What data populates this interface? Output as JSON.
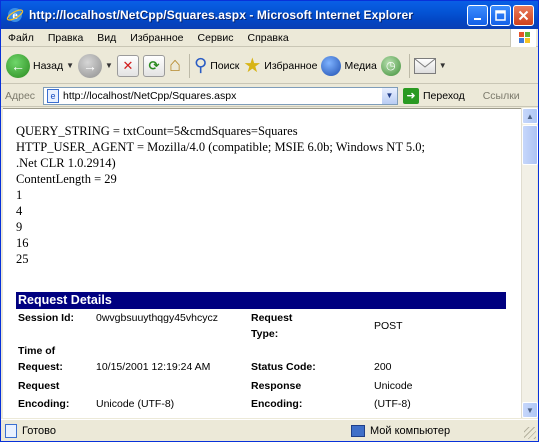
{
  "window": {
    "title": "http://localhost/NetCpp/Squares.aspx - Microsoft Internet Explorer"
  },
  "menu": [
    "Файл",
    "Правка",
    "Вид",
    "Избранное",
    "Сервис",
    "Справка"
  ],
  "toolbar": {
    "back_label": "Назад",
    "search_label": "Поиск",
    "favorites_label": "Избранное",
    "media_label": "Медиа"
  },
  "address": {
    "label": "Адрес",
    "url": "http://localhost/NetCpp/Squares.aspx",
    "go_label": "Переход",
    "links_label": "Ссылки"
  },
  "page": {
    "raw_lines": [
      "QUERY_STRING = txtCount=5&cmdSquares=Squares",
      "HTTP_USER_AGENT = Mozilla/4.0 (compatible; MSIE 6.0b; Windows NT 5.0;",
      ".Net CLR 1.0.2914)",
      "ContentLength = 29",
      "1",
      "4",
      "9",
      "16",
      "25"
    ],
    "request_details_title": "Request Details",
    "details": {
      "session_id_label": "Session Id:",
      "session_id_value": "0wvgbsuuythqgy45vhcycz",
      "request_type_label_1": "Request",
      "request_type_label_2": "Type:",
      "request_type_value": "POST",
      "time_label_1": "Time of",
      "time_label_2": "Request:",
      "time_value": "10/15/2001 12:19:24 AM",
      "status_code_label": "Status Code:",
      "status_code_value": "200",
      "req_encoding_label_1": "Request",
      "req_encoding_label_2": "Encoding:",
      "req_encoding_value": "Unicode (UTF-8)",
      "resp_encoding_label_1": "Response",
      "resp_encoding_label_2": "Encoding:",
      "resp_encoding_value_1": "Unicode",
      "resp_encoding_value_2": "(UTF-8)"
    }
  },
  "status": {
    "text": "Готово",
    "zone": "Мой компьютер"
  }
}
